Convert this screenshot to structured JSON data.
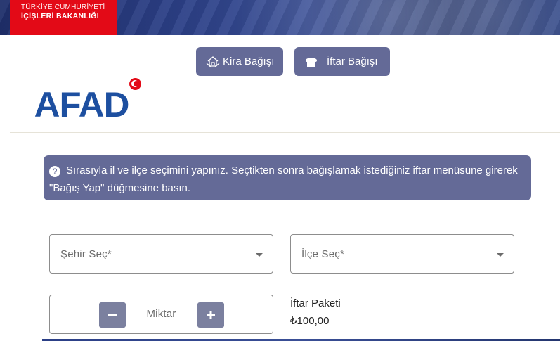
{
  "header": {
    "ministry_line1": "TÜRKİYE CUMHURİYETİ",
    "ministry_line2": "İÇİŞLERİ BAKANLIĞI",
    "banner_color": "#2b3f86",
    "ministry_color": "#e30a17"
  },
  "donation_buttons": {
    "kira": {
      "label": "Kira Bağışı",
      "icon": "house-hands-icon"
    },
    "iftar": {
      "label": "İftar Bağışı",
      "icon": "bread-icon"
    }
  },
  "brand": {
    "logo_text": "AFAD",
    "logo_color": "#1d4fa0",
    "flag_icon": "turkish-flag-icon"
  },
  "info": {
    "icon": "question-circle-icon",
    "text": "Sırasıyla il ve ilçe seçimini yapınız. Seçtikten sonra bağışlamak istediğiniz iftar menüsüne girerek \"Bağış Yap\" düğmesine basın.",
    "bg_color": "#646a97"
  },
  "form": {
    "city_placeholder": "Şehir Seç*",
    "district_placeholder": "İlçe Seç*",
    "quantity_label": "Miktar"
  },
  "package": {
    "name": "İftar Paketi",
    "price": "₺100,00"
  }
}
